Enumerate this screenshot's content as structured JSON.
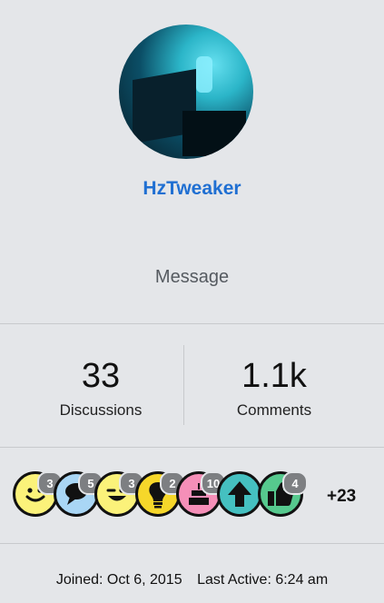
{
  "profile": {
    "username": "HzTweaker",
    "message_label": "Message"
  },
  "stats": {
    "discussions": {
      "value": "33",
      "label": "Discussions"
    },
    "comments": {
      "value": "1.1k",
      "label": "Comments"
    }
  },
  "badges": [
    {
      "icon": "smile-face-icon",
      "color": "#fbf27a",
      "count": "3"
    },
    {
      "icon": "speech-bubble-icon",
      "color": "#a9d6f5",
      "count": "5"
    },
    {
      "icon": "wink-face-icon",
      "color": "#fbf27a",
      "count": "3"
    },
    {
      "icon": "lightbulb-icon",
      "color": "#f6d72a",
      "count": "2"
    },
    {
      "icon": "birthday-cake-icon",
      "color": "#f58fb8",
      "count": "10"
    },
    {
      "icon": "up-arrow-icon",
      "color": "#45c0c0",
      "count": ""
    },
    {
      "icon": "thumbs-up-icon",
      "color": "#56c98e",
      "count": "4"
    }
  ],
  "more_badges": "+23",
  "footer": {
    "joined": "Joined: Oct 6, 2015",
    "last_active": "Last Active: 6:24 am"
  }
}
